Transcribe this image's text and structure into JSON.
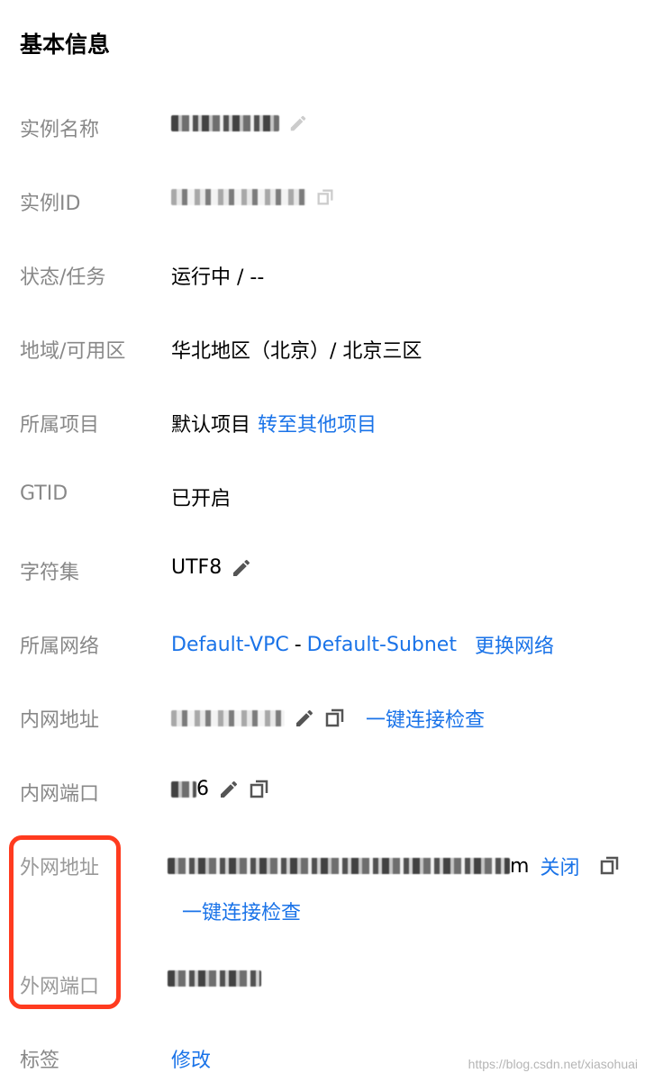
{
  "section_title": "基本信息",
  "rows": {
    "instance_name": {
      "label": "实例名称"
    },
    "instance_id": {
      "label": "实例ID"
    },
    "status": {
      "label": "状态/任务",
      "value": "运行中 / --"
    },
    "region": {
      "label": "地域/可用区",
      "value": "华北地区（北京）/ 北京三区"
    },
    "project": {
      "label": "所属项目",
      "value": "默认项目",
      "link": "转至其他项目"
    },
    "gtid": {
      "label": "GTID",
      "value": "已开启"
    },
    "charset": {
      "label": "字符集",
      "value": "UTF8"
    },
    "network": {
      "label": "所属网络",
      "vpc": "Default-VPC",
      "separator": "-",
      "subnet": "Default-Subnet",
      "link": "更换网络"
    },
    "private_ip": {
      "label": "内网地址",
      "link": "一键连接检查"
    },
    "private_port": {
      "label": "内网端口",
      "value_suffix": "6"
    },
    "public_addr": {
      "label": "外网地址",
      "value_suffix": "m",
      "close_link": "关闭",
      "check_link": "一键连接检查"
    },
    "public_port": {
      "label": "外网端口"
    },
    "tags": {
      "label": "标签",
      "link": "修改"
    }
  },
  "watermark": "https://blog.csdn.net/xiasohuai",
  "colors": {
    "link": "#1a73e8",
    "label": "#888888",
    "highlight": "#ff3b1f"
  },
  "icons": [
    "edit-icon",
    "copy-icon"
  ]
}
